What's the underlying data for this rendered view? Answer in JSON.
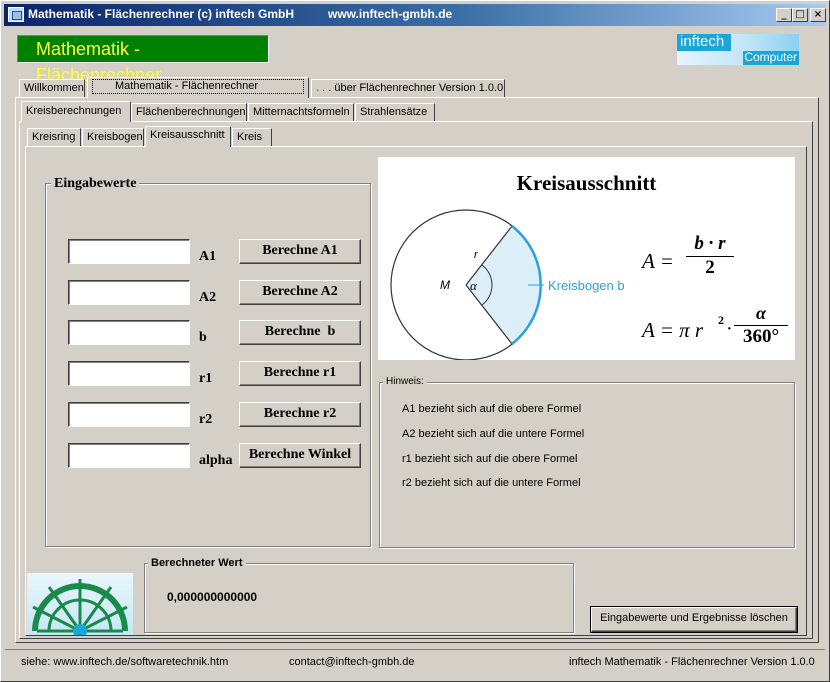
{
  "window": {
    "title": "Mathematik - Flächenrechner (c) inftech GmbH",
    "url": "www.inftech-gmbh.de",
    "buttons": {
      "minimize": "_",
      "maximize": "□",
      "close": "×"
    }
  },
  "header": {
    "app_title": "Mathematik - Flächenrechner",
    "logo_top": "inftech",
    "logo_bottom": "Computer"
  },
  "main_tabs": [
    {
      "label": "Willkommen",
      "active": false
    },
    {
      "label": "Mathematik - Flächenrechner",
      "active": true
    },
    {
      "label": ". . . über Flächenrechner Version 1.0.0",
      "active": false
    }
  ],
  "sub_tabs": [
    {
      "label": "Kreisberechnungen",
      "active": true
    },
    {
      "label": "Flächenberechnungen",
      "active": false
    },
    {
      "label": "Mitternachtsformeln",
      "active": false
    },
    {
      "label": "Strahlensätze",
      "active": false
    }
  ],
  "circle_tabs": [
    {
      "label": "Kreisring",
      "active": false
    },
    {
      "label": "Kreisbogen",
      "active": false
    },
    {
      "label": "Kreisausschnitt",
      "active": true
    },
    {
      "label": "Kreis",
      "active": false
    }
  ],
  "input_group": {
    "title": "Eingabewerte",
    "fields": [
      {
        "value": "",
        "label": "A1",
        "button": "Berechne A1"
      },
      {
        "value": "",
        "label": "A2",
        "button": "Berechne A2"
      },
      {
        "value": "",
        "label": "b",
        "button": "Berechne  b"
      },
      {
        "value": "",
        "label": "r1",
        "button": "Berechne r1"
      },
      {
        "value": "",
        "label": "r2",
        "button": "Berechne r2"
      },
      {
        "value": "",
        "label": "alpha",
        "button": "Berechne Winkel"
      }
    ]
  },
  "figure": {
    "title": "Kreisausschnitt",
    "label_m": "M",
    "label_alpha": "α",
    "label_r": "r",
    "label_arc": "Kreisbogen b",
    "formula1_lhs": "A =",
    "formula1_num": "b · r",
    "formula1_den": "2",
    "formula2_lhs": "A = π r",
    "formula2_exp": "2",
    "formula2_dot": "·",
    "formula2_num": "α",
    "formula2_den": "360°"
  },
  "hint": {
    "title": "Hinweis:",
    "lines": [
      "A1 bezieht sich auf die obere Formel",
      "A2 bezieht sich auf die untere Formel",
      "r1 bezieht sich auf die obere Formel",
      "r2 bezieht sich auf die untere Formel"
    ]
  },
  "result": {
    "title": "Berechneter Wert",
    "value": "0,000000000000"
  },
  "clear_button": "Eingabewerte und Ergebnisse löschen",
  "status_bar": {
    "left": "siehe: www.inftech.de/softwaretechnik.htm",
    "middle": "contact@inftech-gmbh.de",
    "right": "inftech Mathematik - Flächenrechner Version 1.0.0"
  },
  "colors": {
    "title_bar_start": "#0a246a",
    "app_title_bg": "#008000",
    "app_title_text": "#ffff33",
    "logo_accent": "#1aa6d8",
    "arc_color": "#29a3d6",
    "face": "#d4d0c8"
  }
}
